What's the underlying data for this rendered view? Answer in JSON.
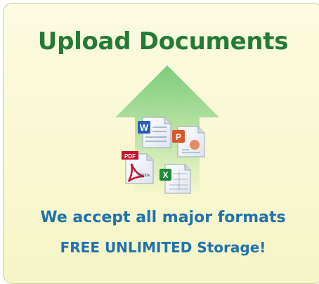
{
  "banner": {
    "title": "Upload Documents",
    "tagline": "We accept all major formats",
    "storage": "FREE UNLIMITED Storage!",
    "pdf_badge": "PDF",
    "pdf_brand": "Adobe",
    "colors": {
      "title": "#237b35",
      "text": "#1f73ad",
      "background": "#fdfbe0",
      "arrow": "#8fd08f"
    },
    "icons": [
      "upload-arrow-icon",
      "word-document-icon",
      "powerpoint-document-icon",
      "pdf-document-icon",
      "excel-document-icon"
    ]
  }
}
